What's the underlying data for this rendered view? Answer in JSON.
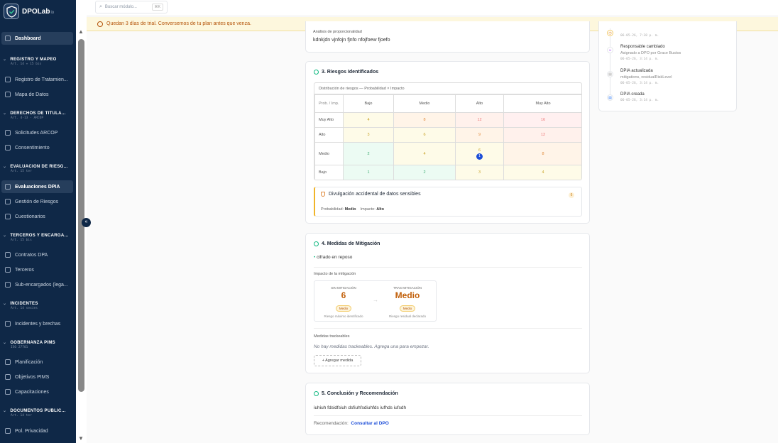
{
  "app": {
    "brand": "DPOLab",
    "brand_suffix": "io"
  },
  "search": {
    "placeholder": "Buscar módulo...",
    "shortcut": "⌘K"
  },
  "trial": {
    "text": "Quedan 3 días de trial. Conversemos de tu plan antes que venza."
  },
  "sidebar": {
    "dashboard": "Dashboard",
    "sections": [
      {
        "title": "REGISTRO Y MAPEO",
        "sub": "Art. 14 + 15 bis",
        "items": [
          "Registro de Tratamien...",
          "Mapa de Datos"
        ]
      },
      {
        "title": "DERECHOS DE TITULA...",
        "sub": "Art. 4-13 · ARCOP",
        "items": [
          "Solicitudes ARCOP",
          "Consentimiento"
        ]
      },
      {
        "title": "EVALUACIÓN DE RIESG...",
        "sub": "Art. 15 ter",
        "items": [
          "Evaluaciones DPIA",
          "Gestión de Riesgos",
          "Cuestionarios"
        ]
      },
      {
        "title": "TERCEROS Y ENCARGA...",
        "sub": "Art. 15 bis",
        "items": [
          "Contratos DPA",
          "Terceros",
          "Sub-encargados (lega..."
        ]
      },
      {
        "title": "INCIDENTES",
        "sub": "Art. 14 sexies",
        "items": [
          "Incidentes y brechas"
        ]
      },
      {
        "title": "GOBERNANZA PIMS",
        "sub": "ISO 27701",
        "items": [
          "Planificación",
          "Objetivos PIMS",
          "Capacitaciones"
        ]
      },
      {
        "title": "DOCUMENTOS PÚBLIC...",
        "sub": "Art. 14 ter",
        "items": [
          "Pol. Privacidad"
        ]
      }
    ]
  },
  "proportionality": {
    "label": "Análisis de proporcionalidad",
    "text": "kdnkjdn vjnfojn fjnfo nfojfoew fjoefo"
  },
  "risks": {
    "title": "3. Riesgos Identificados",
    "matrix_caption": "Distribución de riesgos — Probabilidad × Impacto",
    "corner": "Prob. / Imp.",
    "cols": [
      "Bajo",
      "Medio",
      "Alto",
      "Muy Alto"
    ],
    "rows": [
      {
        "label": "Muy Alto",
        "cells": [
          "4",
          "8",
          "12",
          "16"
        ]
      },
      {
        "label": "Alto",
        "cells": [
          "3",
          "6",
          "9",
          "12"
        ]
      },
      {
        "label": "Medio",
        "cells": [
          "2",
          "4",
          "6",
          "8"
        ]
      },
      {
        "label": "Bajo",
        "cells": [
          "1",
          "2",
          "3",
          "4"
        ]
      }
    ],
    "marker": "1",
    "risk_item": {
      "name": "Divulgación accidental de datos sensibles",
      "score": "6",
      "prob_label": "Probabilidad:",
      "prob": "Medio",
      "imp_label": "Impacto:",
      "imp": "Alto"
    }
  },
  "mitigation": {
    "title": "4. Medidas de Mitigación",
    "measure": "cifrado en reposo",
    "impact_label": "Impacto de la mitigación",
    "before": {
      "label": "SIN MITIGACIÓN",
      "value": "6",
      "badge": "Medio",
      "note": "Riesgo máximo identificado"
    },
    "after": {
      "label": "TRAS MITIGACIÓN",
      "value": "Medio",
      "badge": "Medio",
      "note": "Riesgo residual declarado"
    },
    "trackable_label": "Medidas trackeables",
    "empty": "No hay medidas trackeables. Agrega una para empezar.",
    "add": "+ Agregar medida"
  },
  "conclusion": {
    "title": "5. Conclusión y Recomendación",
    "text": "iuhiuh fdsidfsiuh dsfiuhfsdiuhfds iufhds iufsdh",
    "rec_label": "Recomendación:",
    "rec_value": "Consultar al DPO"
  },
  "timeline": [
    {
      "title": "",
      "sub": "",
      "date": "06-05-26, 7:38 p. m."
    },
    {
      "title": "Responsable cambiado",
      "sub": "Asignado a DPO por Grace Bustos",
      "date": "06-05-26, 3:14 p. m."
    },
    {
      "title": "DPIA actualizada",
      "sub": "mitigations, residualRiskLevel",
      "date": "06-05-26, 3:14 p. m."
    },
    {
      "title": "DPIA creada",
      "sub": "",
      "date": "06-05-26, 3:14 p. m."
    }
  ]
}
